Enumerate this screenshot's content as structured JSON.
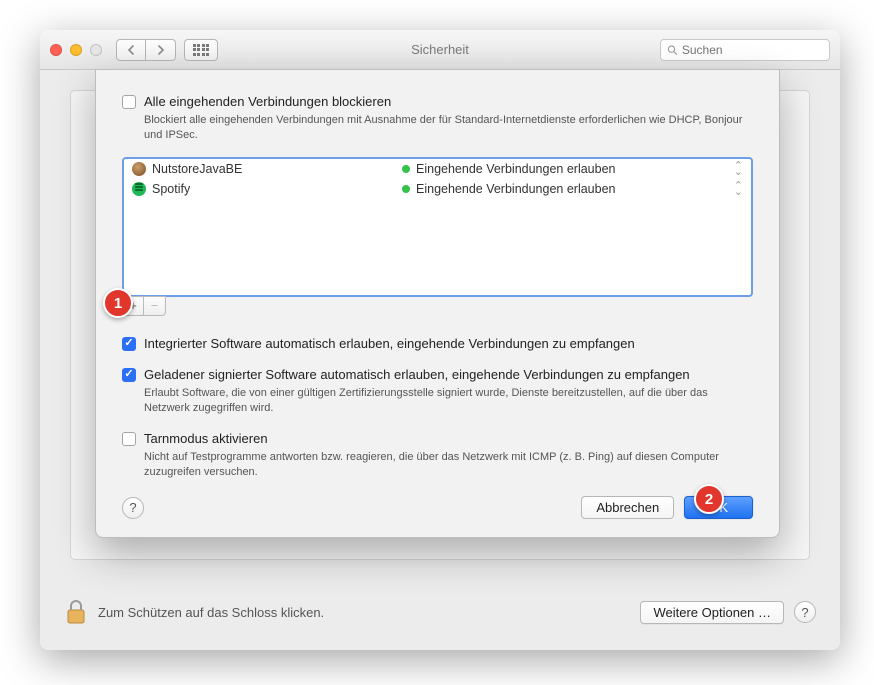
{
  "window": {
    "title": "Sicherheit",
    "search_placeholder": "Suchen"
  },
  "sheet": {
    "block_all": {
      "label": "Alle eingehenden Verbindungen blockieren",
      "desc": "Blockiert alle eingehenden Verbindungen mit Ausnahme der für Standard-Internetdienste erforderlichen wie DHCP, Bonjour und IPSec."
    },
    "apps": [
      {
        "name": "NutstoreJavaBE",
        "status": "Eingehende Verbindungen erlauben"
      },
      {
        "name": "Spotify",
        "status": "Eingehende Verbindungen erlauben"
      }
    ],
    "add": "+",
    "remove": "−",
    "builtin": {
      "label": "Integrierter Software automatisch erlauben, eingehende Verbindungen zu empfangen"
    },
    "signed": {
      "label": "Geladener signierter Software automatisch erlauben, eingehende Verbindungen zu empfangen",
      "desc": "Erlaubt Software, die von einer gültigen Zertifizierungsstelle signiert wurde, Dienste bereitzustellen, auf die über das Netzwerk zugegriffen wird."
    },
    "stealth": {
      "label": "Tarnmodus aktivieren",
      "desc": "Nicht auf Testprogramme antworten bzw. reagieren, die über das Netzwerk mit ICMP (z. B. Ping) auf diesen Computer zuzugreifen versuchen."
    },
    "cancel": "Abbrechen",
    "ok": "OK",
    "help": "?"
  },
  "footer": {
    "lock_text": "Zum Schützen auf das Schloss klicken.",
    "more_options": "Weitere Optionen …",
    "help": "?"
  },
  "callouts": {
    "c1": "1",
    "c2": "2"
  }
}
